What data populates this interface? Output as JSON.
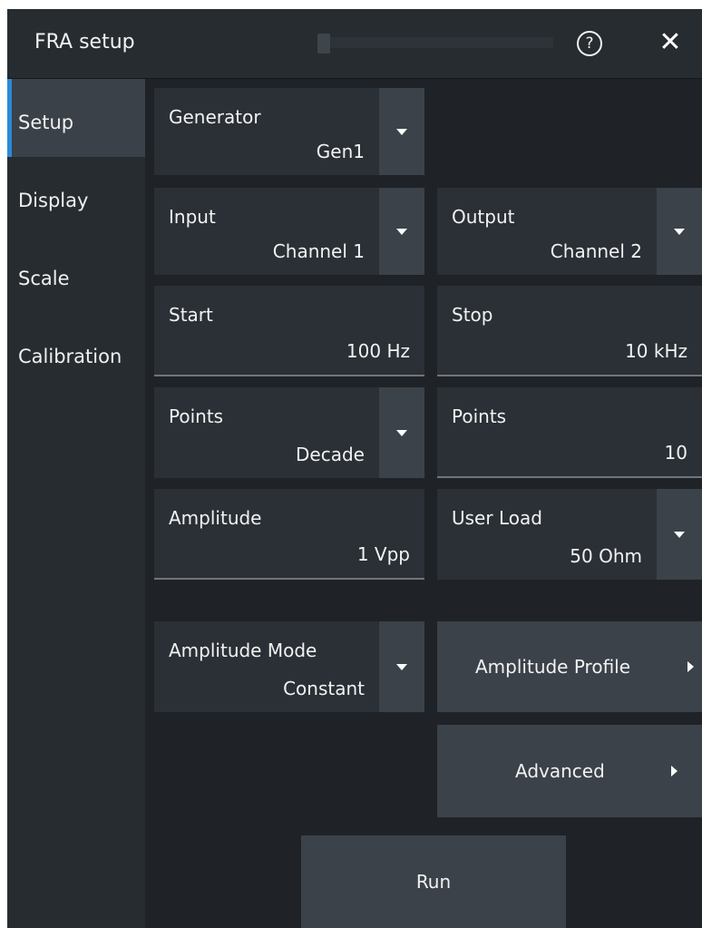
{
  "dialog": {
    "title": "FRA setup",
    "help_glyph": "?",
    "close_glyph": "✕",
    "icons": [
      "help-icon",
      "close-icon",
      "dropdown-arrow-icon",
      "chevron-right-icon"
    ],
    "accent_color": "#2a8ad8"
  },
  "sidebar": {
    "items": [
      {
        "label": "Setup",
        "active": true
      },
      {
        "label": "Display",
        "active": false
      },
      {
        "label": "Scale",
        "active": false
      },
      {
        "label": "Calibration",
        "active": false
      }
    ]
  },
  "setup": {
    "generator": {
      "label": "Generator",
      "value": "Gen1"
    },
    "input": {
      "label": "Input",
      "value": "Channel 1"
    },
    "output": {
      "label": "Output",
      "value": "Channel 2"
    },
    "start": {
      "label": "Start",
      "value": "100 Hz"
    },
    "stop": {
      "label": "Stop",
      "value": "10 kHz"
    },
    "points_mode": {
      "label": "Points",
      "value": "Decade"
    },
    "points_count": {
      "label": "Points",
      "value": "10"
    },
    "amplitude": {
      "label": "Amplitude",
      "value": "1 Vpp"
    },
    "user_load": {
      "label": "User Load",
      "value": "50 Ohm"
    },
    "amplitude_mode": {
      "label": "Amplitude Mode",
      "value": "Constant"
    },
    "amplitude_profile_label": "Amplitude Profile",
    "advanced_label": "Advanced",
    "run_label": "Run"
  }
}
